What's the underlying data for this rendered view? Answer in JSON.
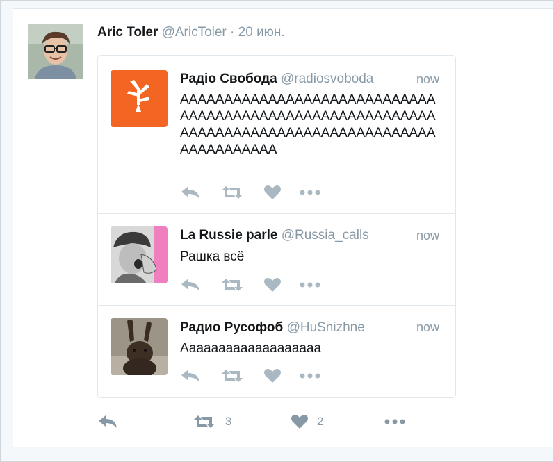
{
  "tweet": {
    "author_name": "Aric Toler",
    "author_handle": "@AricToler",
    "separator": "·",
    "date": "20 июн.",
    "retweet_count": "3",
    "like_count": "2"
  },
  "quoted": [
    {
      "name": "Радіо Свобода",
      "handle": "@radiosvoboda",
      "time": "now",
      "text": "AAAAAAAAAAAAAAAAAAAAAAAAAAAAAAAAAAAAAAAAAAAAAAAAAAAAAAAAAAAAAAAAAAAAAAAAAAAAAAAAAAAAAAAAAAAAAAAAAA"
    },
    {
      "name": "La Russie parle",
      "handle": "@Russia_calls",
      "time": "now",
      "text": "Рашка всё"
    },
    {
      "name": "Радио Русофоб",
      "handle": "@HuSnizhne",
      "time": "now",
      "text": "Ааааааааааааааааааа"
    }
  ],
  "colors": {
    "svoboda_orange": "#f26522",
    "icon_gray": "#aab8c2",
    "main_icon_gray": "#8899a6",
    "pink_bg": "#f07fc0"
  },
  "icons": [
    "reply-icon",
    "retweet-icon",
    "heart-icon",
    "more-icon"
  ]
}
